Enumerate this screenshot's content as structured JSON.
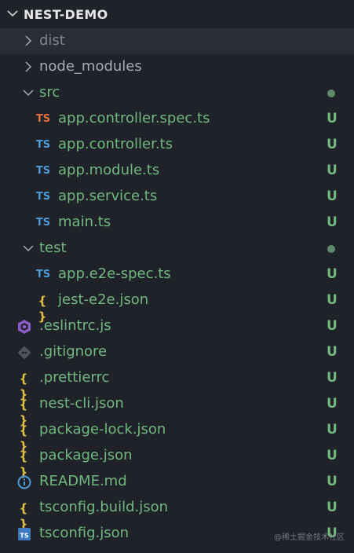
{
  "explorer": {
    "root_title": "NEST-DEMO",
    "status_color_untracked": "#71b77f",
    "status_color_modified_dot": "#5e8a6a",
    "items": [
      {
        "label": "dist",
        "kind": "folder",
        "expanded": false,
        "color": "#7f848e"
      },
      {
        "label": "node_modules",
        "kind": "folder",
        "expanded": false,
        "color": "#a6abb3"
      },
      {
        "label": "src",
        "kind": "folder",
        "expanded": true,
        "color": "#71b77f",
        "badge": "dot"
      },
      {
        "label": "app.controller.spec.ts",
        "kind": "ts-spec",
        "color": "#71b77f",
        "status": "U"
      },
      {
        "label": "app.controller.ts",
        "kind": "ts",
        "color": "#71b77f",
        "status": "U"
      },
      {
        "label": "app.module.ts",
        "kind": "ts",
        "color": "#71b77f",
        "status": "U"
      },
      {
        "label": "app.service.ts",
        "kind": "ts",
        "color": "#71b77f",
        "status": "U"
      },
      {
        "label": "main.ts",
        "kind": "ts",
        "color": "#71b77f",
        "status": "U"
      },
      {
        "label": "test",
        "kind": "folder",
        "expanded": true,
        "color": "#71b77f",
        "badge": "dot"
      },
      {
        "label": "app.e2e-spec.ts",
        "kind": "ts",
        "color": "#71b77f",
        "status": "U"
      },
      {
        "label": "jest-e2e.json",
        "kind": "json",
        "color": "#71b77f",
        "status": "U"
      },
      {
        "label": ".eslintrc.js",
        "kind": "eslint",
        "color": "#71b77f",
        "status": "U"
      },
      {
        "label": ".gitignore",
        "kind": "git",
        "color": "#71b77f",
        "status": "U"
      },
      {
        "label": ".prettierrc",
        "kind": "json",
        "color": "#71b77f",
        "status": "U"
      },
      {
        "label": "nest-cli.json",
        "kind": "json",
        "color": "#71b77f",
        "status": "U"
      },
      {
        "label": "package-lock.json",
        "kind": "json",
        "color": "#71b77f",
        "status": "U"
      },
      {
        "label": "package.json",
        "kind": "json",
        "color": "#71b77f",
        "status": "U"
      },
      {
        "label": "README.md",
        "kind": "info",
        "color": "#71b77f",
        "status": "U"
      },
      {
        "label": "tsconfig.build.json",
        "kind": "json",
        "color": "#71b77f",
        "status": "U"
      },
      {
        "label": "tsconfig.json",
        "kind": "tsconfig",
        "color": "#71b77f",
        "status": "U"
      }
    ],
    "icon_glyphs": {
      "ts": "TS",
      "json": "{ }"
    }
  },
  "watermark": "@稀土掘金技术社区"
}
